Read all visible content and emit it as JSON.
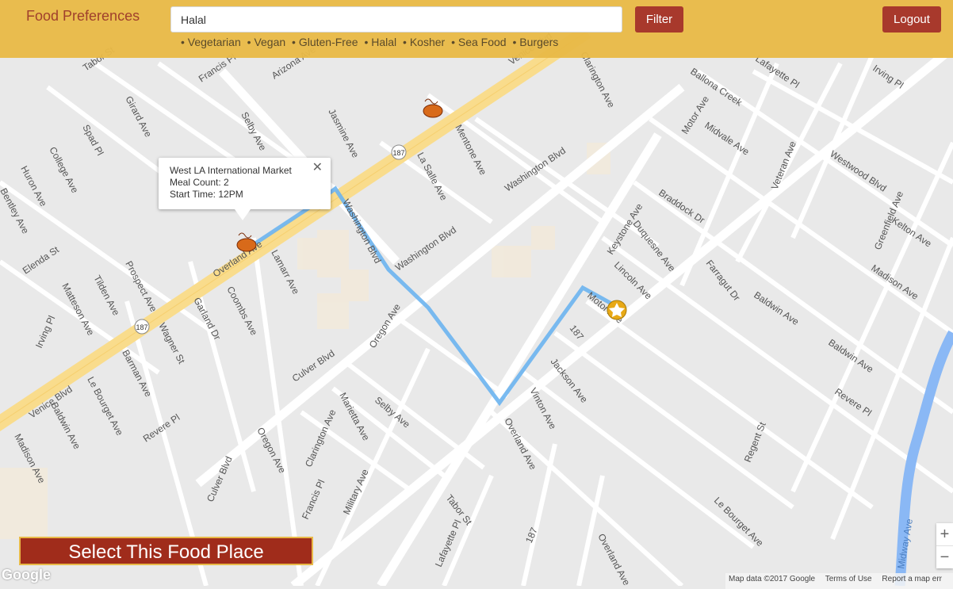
{
  "header": {
    "title": "Food Preferences",
    "search_value": "Halal",
    "filter_label": "Filter",
    "logout_label": "Logout",
    "tags": [
      "Vegetarian",
      "Vegan",
      "Gluten-Free",
      "Halal",
      "Kosher",
      "Sea Food",
      "Burgers"
    ]
  },
  "popup": {
    "name": "West LA International Market",
    "meal_count": "Meal Count: 2",
    "start_time": "Start Time: 12PM",
    "close_label": "✕"
  },
  "select_button_label": "Select This Food Place",
  "map": {
    "google_logo": "Google",
    "attribution": [
      "Map data ©2017 Google",
      "Terms of Use",
      "Report a map err"
    ],
    "zoom_in": "+",
    "zoom_out": "−",
    "route_color": "#6cb4f0",
    "highway_color": "#f9dc8c",
    "streets": [
      "Venice Blvd",
      "Venice Blvd",
      "Overland Ave",
      "Washington Blvd",
      "Washington Blvd",
      "Washington Blvd",
      "Culver Blvd",
      "Culver Blvd",
      "Motor Ave",
      "Keystone Ave",
      "Mentone Ave",
      "Jasmine Ave",
      "Vinton Ave",
      "La Salle Ave",
      "Jackson Ave",
      "Duquesne Ave",
      "Lincoln Ave",
      "Braddock Dr",
      "Farragut Dr",
      "Ballona Creek",
      "Westwood Blvd",
      "Midvale Ave",
      "Kelton Ave",
      "Veteran Ave",
      "Greenfield Ave",
      "Regent St",
      "Midway Ave",
      "Girard Ave",
      "Spad Pl",
      "College Ave",
      "Prospect Ave",
      "Huron Ave",
      "Tilden Ave",
      "Bentley Ave",
      "Matteson Ave",
      "Elenda St",
      "Arizona Ave",
      "Lamarr Ave",
      "Marietta Ave",
      "Garland Dr",
      "Coombs Ave",
      "Wagner St",
      "Barman Ave",
      "Le Bourget Ave",
      "Baldwin Ave",
      "Madison Ave",
      "Irving Pl",
      "Revere Pl",
      "Oregon Ave",
      "Clarington Ave",
      "Selby Ave",
      "Francis Pl",
      "Military Ave",
      "Tabor St",
      "Lafayette Pl",
      "187",
      "187"
    ]
  },
  "icons": {
    "food_marker": "ramen-bowl-icon",
    "destination_marker": "star-marker-icon"
  }
}
